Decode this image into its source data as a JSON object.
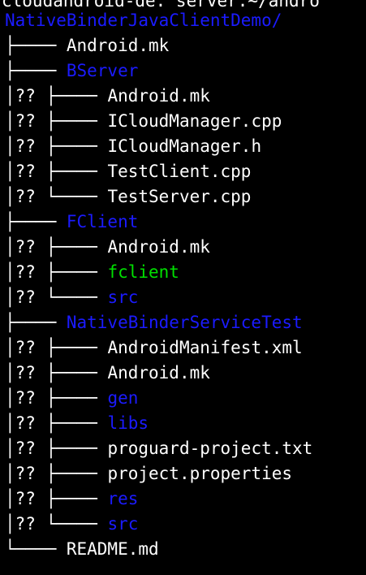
{
  "terminal": {
    "prompt": "cloudandroid-de: server:~/andro",
    "root": "NativeBinderJavaClientDemo/",
    "colors": {
      "background": "#000000",
      "text": "#ffffff",
      "directory": "#1b1bff",
      "executable": "#00e000"
    },
    "lines": [
      {
        "prefix": "├──── ",
        "name": "Android.mk",
        "kind": "file"
      },
      {
        "prefix": "├──── ",
        "name": "BServer",
        "kind": "dir"
      },
      {
        "prefix": "│?? ├──── ",
        "name": "Android.mk",
        "kind": "file"
      },
      {
        "prefix": "│?? ├──── ",
        "name": "ICloudManager.cpp",
        "kind": "file"
      },
      {
        "prefix": "│?? ├──── ",
        "name": "ICloudManager.h",
        "kind": "file"
      },
      {
        "prefix": "│?? ├──── ",
        "name": "TestClient.cpp",
        "kind": "file"
      },
      {
        "prefix": "│?? └──── ",
        "name": "TestServer.cpp",
        "kind": "file"
      },
      {
        "prefix": "├──── ",
        "name": "FClient",
        "kind": "dir"
      },
      {
        "prefix": "│?? ├──── ",
        "name": "Android.mk",
        "kind": "file"
      },
      {
        "prefix": "│?? ├──── ",
        "name": "fclient",
        "kind": "exe"
      },
      {
        "prefix": "│?? └──── ",
        "name": "src",
        "kind": "dir"
      },
      {
        "prefix": "├──── ",
        "name": "NativeBinderServiceTest",
        "kind": "dir"
      },
      {
        "prefix": "│?? ├──── ",
        "name": "AndroidManifest.xml",
        "kind": "file"
      },
      {
        "prefix": "│?? ├──── ",
        "name": "Android.mk",
        "kind": "file"
      },
      {
        "prefix": "│?? ├──── ",
        "name": "gen",
        "kind": "dir"
      },
      {
        "prefix": "│?? ├──── ",
        "name": "libs",
        "kind": "dir"
      },
      {
        "prefix": "│?? ├──── ",
        "name": "proguard-project.txt",
        "kind": "file"
      },
      {
        "prefix": "│?? ├──── ",
        "name": "project.properties",
        "kind": "file"
      },
      {
        "prefix": "│?? ├──── ",
        "name": "res",
        "kind": "dir"
      },
      {
        "prefix": "│?? └──── ",
        "name": "src",
        "kind": "dir"
      },
      {
        "prefix": "└──── ",
        "name": "README.md",
        "kind": "file"
      }
    ]
  }
}
